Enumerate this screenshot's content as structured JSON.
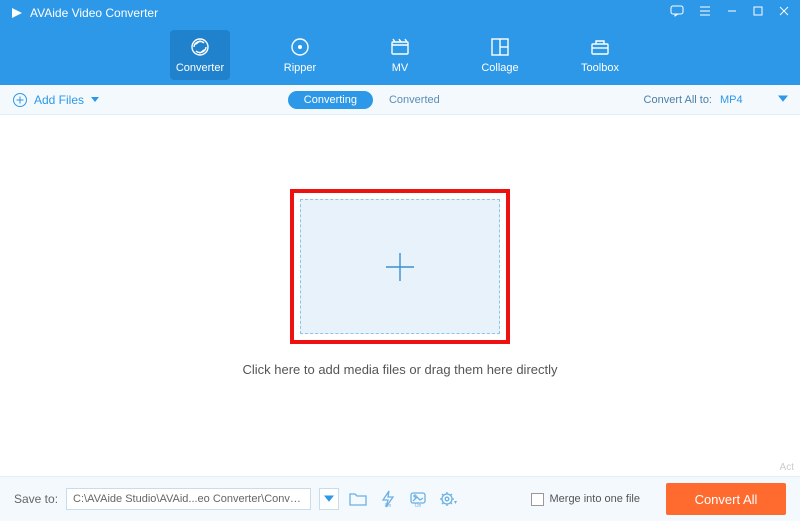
{
  "window": {
    "title": "AVAide Video Converter"
  },
  "nav": {
    "items": [
      {
        "label": "Converter",
        "active": true
      },
      {
        "label": "Ripper",
        "active": false
      },
      {
        "label": "MV",
        "active": false
      },
      {
        "label": "Collage",
        "active": false
      },
      {
        "label": "Toolbox",
        "active": false
      }
    ]
  },
  "subbar": {
    "add_files_label": "Add Files",
    "tabs": {
      "converting": "Converting",
      "converted": "Converted",
      "active": "converting"
    },
    "convert_all_to_label": "Convert All to:",
    "convert_all_to_value": "MP4"
  },
  "workspace": {
    "hint": "Click here to add media files or drag them here directly"
  },
  "bottombar": {
    "save_to_label": "Save to:",
    "save_to_path": "C:\\AVAide Studio\\AVAid...eo Converter\\Converted",
    "merge_label": "Merge into one file",
    "convert_button": "Convert All"
  },
  "watermark": "Act",
  "colors": {
    "primary": "#2d98e7",
    "primary_dark": "#2082cc",
    "accent": "#ff6a2f",
    "highlight_frame": "#e11"
  }
}
